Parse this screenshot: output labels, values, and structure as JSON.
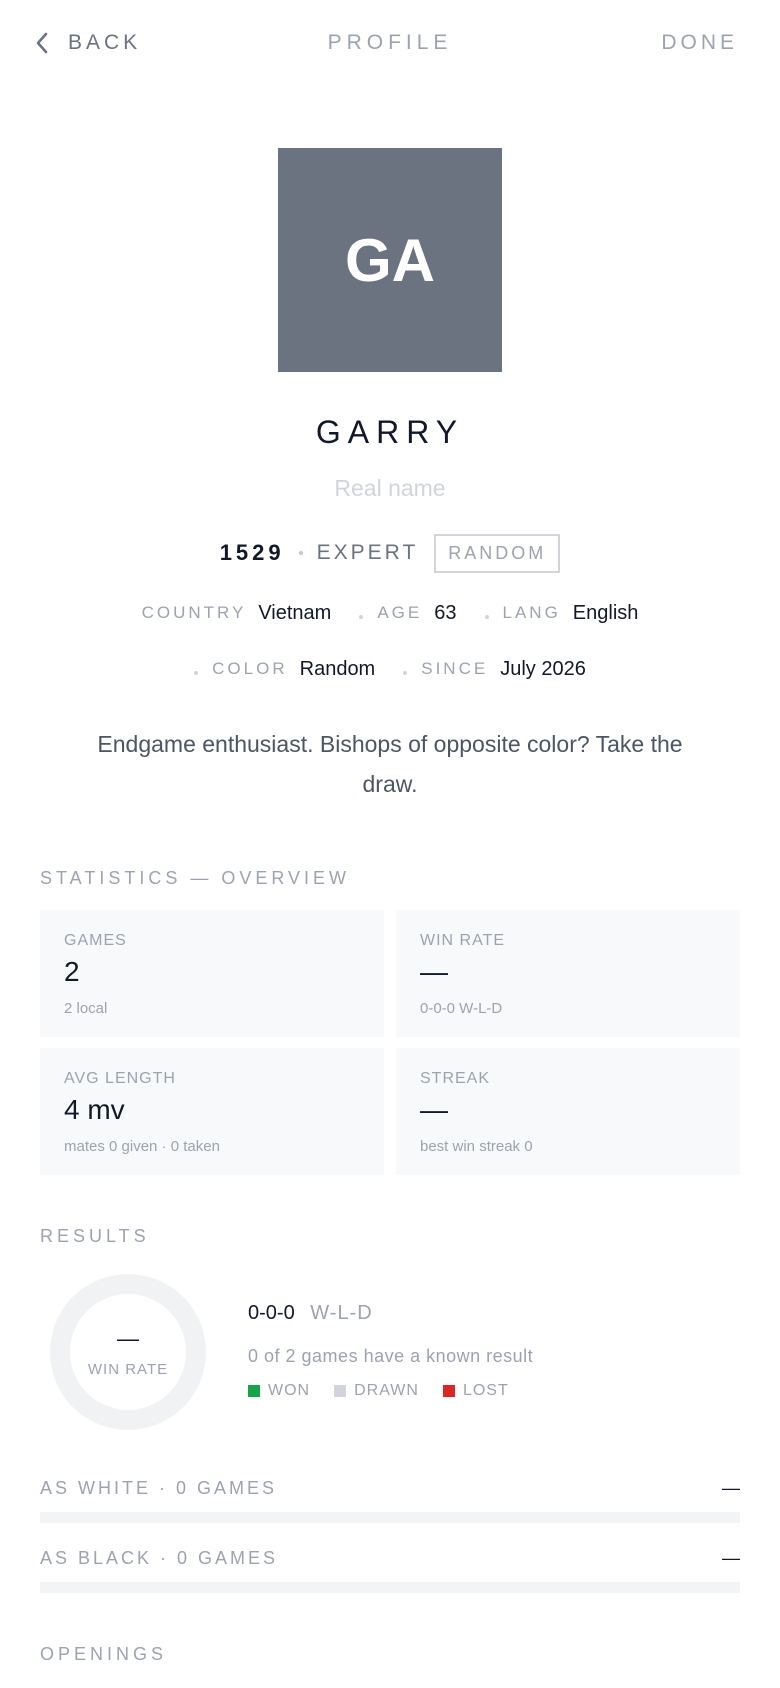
{
  "nav": {
    "back_label": "BACK",
    "title": "PROFILE",
    "done_label": "DONE"
  },
  "profile": {
    "initials": "GA",
    "username": "GARRY",
    "real_name_placeholder": "Real name",
    "rating": "1529",
    "level": "EXPERT",
    "badge": "RANDOM",
    "country_label": "COUNTRY",
    "country": "Vietnam",
    "age_label": "AGE",
    "age": "63",
    "lang_label": "LANG",
    "lang": "English",
    "color_label": "COLOR",
    "color": "Random",
    "since_label": "SINCE",
    "since": "July 2026",
    "bio": "Endgame enthusiast. Bishops of opposite color? Take the draw."
  },
  "stats": {
    "title": "STATISTICS — OVERVIEW",
    "cards": [
      {
        "label": "GAMES",
        "value": "2",
        "sub": "2 local"
      },
      {
        "label": "WIN RATE",
        "value": "—",
        "sub": "0-0-0 W-L-D"
      },
      {
        "label": "AVG LENGTH",
        "value": "4 mv",
        "sub": "mates 0 given · 0 taken"
      },
      {
        "label": "STREAK",
        "value": "—",
        "sub": "best win streak 0"
      }
    ]
  },
  "results": {
    "title": "RESULTS",
    "donut_value": "—",
    "donut_label": "WIN RATE",
    "score": "0-0-0",
    "score_unit": "W-L-D",
    "known_text": "0 of 2 games have a known result",
    "legend": [
      {
        "label": "WON",
        "color": "#16a34a"
      },
      {
        "label": "DRAWN",
        "color": "#d1d5db"
      },
      {
        "label": "LOST",
        "color": "#dc2626"
      }
    ],
    "as_white_label": "AS WHITE · 0 GAMES",
    "as_white_value": "—",
    "as_white_fraction": 0,
    "as_black_label": "AS BLACK · 0 GAMES",
    "as_black_value": "—",
    "as_black_fraction": 0
  },
  "openings": {
    "title": "OPENINGS"
  },
  "colors": {
    "avatar_bg": "#6b7280",
    "won": "#16a34a",
    "drawn": "#d1d5db",
    "lost": "#dc2626"
  }
}
